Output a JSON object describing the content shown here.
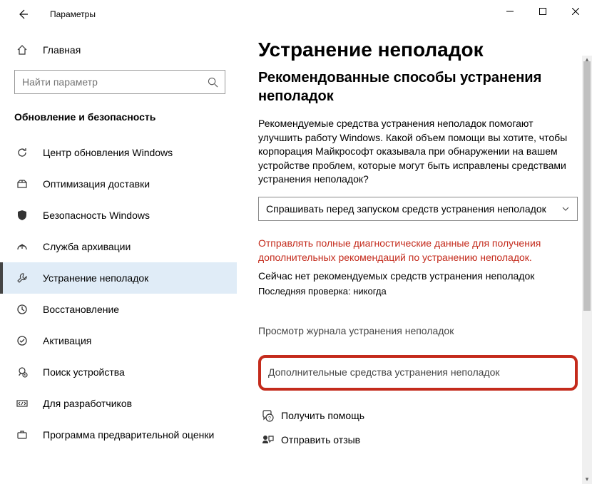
{
  "titlebar": {
    "app_title": "Параметры"
  },
  "sidebar": {
    "home_label": "Главная",
    "search_placeholder": "Найти параметр",
    "section_header": "Обновление и безопасность",
    "items": [
      {
        "label": "Центр обновления Windows",
        "icon": "refresh"
      },
      {
        "label": "Оптимизация доставки",
        "icon": "delivery"
      },
      {
        "label": "Безопасность Windows",
        "icon": "shield"
      },
      {
        "label": "Служба архивации",
        "icon": "backup"
      },
      {
        "label": "Устранение неполадок",
        "icon": "wrench",
        "selected": true
      },
      {
        "label": "Восстановление",
        "icon": "recovery"
      },
      {
        "label": "Активация",
        "icon": "activation"
      },
      {
        "label": "Поиск устройства",
        "icon": "find"
      },
      {
        "label": "Для разработчиков",
        "icon": "dev"
      },
      {
        "label": "Программа предварительной оценки",
        "icon": "insider"
      }
    ]
  },
  "main": {
    "title": "Устранение неполадок",
    "subtitle": "Рекомендованные способы устранения неполадок",
    "description": "Рекомендуемые средства устранения неполадок помогают улучшить работу Windows. Какой объем помощи вы хотите, чтобы корпорация Майкрософт оказывала при обнаружении на вашем устройстве проблем, которые могут быть исправлены средствами устранения неполадок?",
    "select_value": "Спрашивать перед запуском средств устранения неполадок",
    "red_notice": "Отправлять полные диагностические данные для получения дополнительных рекомендаций по устранению неполадок.",
    "status": "Сейчас нет рекомендуемых средств устранения неполадок",
    "last_check": "Последняя проверка: никогда",
    "history_link": "Просмотр журнала устранения неполадок",
    "additional_link": "Дополнительные средства устранения неполадок",
    "help_link": "Получить помощь",
    "feedback_link": "Отправить отзыв"
  }
}
